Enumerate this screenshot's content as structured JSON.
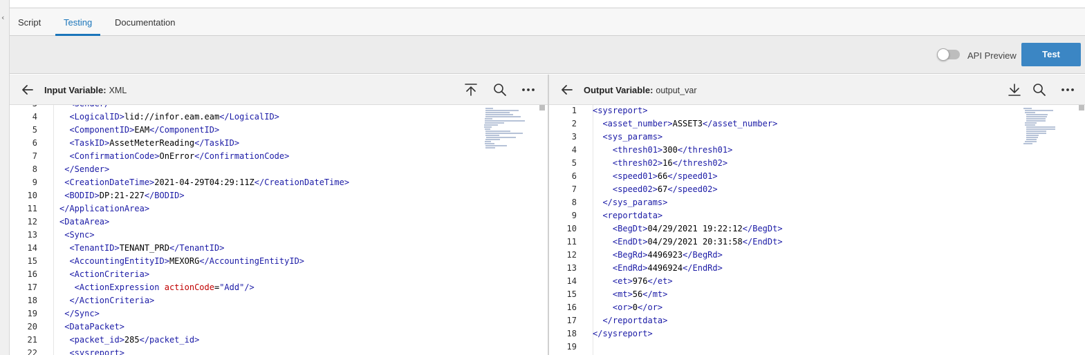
{
  "tabs": [
    {
      "label": "Script",
      "active": false
    },
    {
      "label": "Testing",
      "active": true
    },
    {
      "label": "Documentation",
      "active": false
    }
  ],
  "toolbar": {
    "api_preview_label": "API Preview",
    "api_preview_on": false,
    "test_label": "Test"
  },
  "input_pane": {
    "title_label": "Input Variable:",
    "title_value": "XML",
    "icons": [
      "back-arrow-icon",
      "upload-icon",
      "search-icon",
      "more-icon"
    ],
    "lines": [
      {
        "n": "3",
        "segs": [
          [
            "tag",
            "  <Sender/"
          ]
        ]
      },
      {
        "n": "4",
        "segs": [
          [
            "tag",
            "  <LogicalID>"
          ],
          [
            "txt",
            "lid://infor.eam.eam"
          ],
          [
            "tag",
            "</LogicalID>"
          ]
        ]
      },
      {
        "n": "5",
        "segs": [
          [
            "tag",
            "  <ComponentID>"
          ],
          [
            "txt",
            "EAM"
          ],
          [
            "tag",
            "</ComponentID>"
          ]
        ]
      },
      {
        "n": "6",
        "segs": [
          [
            "tag",
            "  <TaskID>"
          ],
          [
            "txt",
            "AssetMeterReading"
          ],
          [
            "tag",
            "</TaskID>"
          ]
        ]
      },
      {
        "n": "7",
        "segs": [
          [
            "tag",
            "  <ConfirmationCode>"
          ],
          [
            "txt",
            "OnError"
          ],
          [
            "tag",
            "</ConfirmationCode>"
          ]
        ]
      },
      {
        "n": "8",
        "segs": [
          [
            "tag",
            " </Sender>"
          ]
        ]
      },
      {
        "n": "9",
        "segs": [
          [
            "tag",
            " <CreationDateTime>"
          ],
          [
            "txt",
            "2021-04-29T04:29:11Z"
          ],
          [
            "tag",
            "</CreationDateTime>"
          ]
        ]
      },
      {
        "n": "10",
        "segs": [
          [
            "tag",
            " <BODID>"
          ],
          [
            "txt",
            "DP:21-227"
          ],
          [
            "tag",
            "</BODID>"
          ]
        ]
      },
      {
        "n": "11",
        "segs": [
          [
            "tag",
            "</ApplicationArea>"
          ]
        ]
      },
      {
        "n": "12",
        "segs": [
          [
            "tag",
            "<DataArea>"
          ]
        ]
      },
      {
        "n": "13",
        "segs": [
          [
            "tag",
            " <Sync>"
          ]
        ]
      },
      {
        "n": "14",
        "segs": [
          [
            "tag",
            "  <TenantID>"
          ],
          [
            "txt",
            "TENANT_PRD"
          ],
          [
            "tag",
            "</TenantID>"
          ]
        ]
      },
      {
        "n": "15",
        "segs": [
          [
            "tag",
            "  <AccountingEntityID>"
          ],
          [
            "txt",
            "MEXORG"
          ],
          [
            "tag",
            "</AccountingEntityID>"
          ]
        ]
      },
      {
        "n": "16",
        "segs": [
          [
            "tag",
            "  <ActionCriteria>"
          ]
        ]
      },
      {
        "n": "17",
        "segs": [
          [
            "tag",
            "   <ActionExpression "
          ],
          [
            "attr",
            "actionCode"
          ],
          [
            "txt",
            "="
          ],
          [
            "str",
            "\"Add\""
          ],
          [
            "tag",
            "/>"
          ]
        ]
      },
      {
        "n": "18",
        "segs": [
          [
            "tag",
            "  </ActionCriteria>"
          ]
        ]
      },
      {
        "n": "19",
        "segs": [
          [
            "tag",
            " </Sync>"
          ]
        ]
      },
      {
        "n": "20",
        "segs": [
          [
            "tag",
            " <DataPacket>"
          ]
        ]
      },
      {
        "n": "21",
        "segs": [
          [
            "tag",
            "  <packet_id>"
          ],
          [
            "txt",
            "285"
          ],
          [
            "tag",
            "</packet_id>"
          ]
        ]
      },
      {
        "n": "22",
        "segs": [
          [
            "tag",
            "  <sysreport>"
          ]
        ]
      }
    ]
  },
  "output_pane": {
    "title_label": "Output Variable:",
    "title_value": "output_var",
    "icons": [
      "back-arrow-icon",
      "download-icon",
      "search-icon",
      "more-icon"
    ],
    "lines": [
      {
        "n": "1",
        "segs": [
          [
            "tag",
            "<sysreport>"
          ]
        ]
      },
      {
        "n": "2",
        "segs": [
          [
            "tag",
            "  <asset_number>"
          ],
          [
            "txt",
            "ASSET3"
          ],
          [
            "tag",
            "</asset_number>"
          ]
        ]
      },
      {
        "n": "3",
        "segs": [
          [
            "tag",
            "  <sys_params>"
          ]
        ]
      },
      {
        "n": "4",
        "segs": [
          [
            "tag",
            "    <thresh01>"
          ],
          [
            "txt",
            "300"
          ],
          [
            "tag",
            "</thresh01>"
          ]
        ]
      },
      {
        "n": "5",
        "segs": [
          [
            "tag",
            "    <thresh02>"
          ],
          [
            "txt",
            "16"
          ],
          [
            "tag",
            "</thresh02>"
          ]
        ]
      },
      {
        "n": "6",
        "segs": [
          [
            "tag",
            "    <speed01>"
          ],
          [
            "txt",
            "66"
          ],
          [
            "tag",
            "</speed01>"
          ]
        ]
      },
      {
        "n": "7",
        "segs": [
          [
            "tag",
            "    <speed02>"
          ],
          [
            "txt",
            "67"
          ],
          [
            "tag",
            "</speed02>"
          ]
        ]
      },
      {
        "n": "8",
        "segs": [
          [
            "tag",
            "  </sys_params>"
          ]
        ]
      },
      {
        "n": "9",
        "segs": [
          [
            "tag",
            "  <reportdata>"
          ]
        ]
      },
      {
        "n": "10",
        "segs": [
          [
            "tag",
            "    <BegDt>"
          ],
          [
            "txt",
            "04/29/2021 19:22:12"
          ],
          [
            "tag",
            "</BegDt>"
          ]
        ]
      },
      {
        "n": "11",
        "segs": [
          [
            "tag",
            "    <EndDt>"
          ],
          [
            "txt",
            "04/29/2021 20:31:58"
          ],
          [
            "tag",
            "</EndDt>"
          ]
        ]
      },
      {
        "n": "12",
        "segs": [
          [
            "tag",
            "    <BegRd>"
          ],
          [
            "txt",
            "4496923"
          ],
          [
            "tag",
            "</BegRd>"
          ]
        ]
      },
      {
        "n": "13",
        "segs": [
          [
            "tag",
            "    <EndRd>"
          ],
          [
            "txt",
            "4496924"
          ],
          [
            "tag",
            "</EndRd>"
          ]
        ]
      },
      {
        "n": "14",
        "segs": [
          [
            "tag",
            "    <et>"
          ],
          [
            "txt",
            "976"
          ],
          [
            "tag",
            "</et>"
          ]
        ]
      },
      {
        "n": "15",
        "segs": [
          [
            "tag",
            "    <mt>"
          ],
          [
            "txt",
            "56"
          ],
          [
            "tag",
            "</mt>"
          ]
        ]
      },
      {
        "n": "16",
        "segs": [
          [
            "tag",
            "    <or>"
          ],
          [
            "txt",
            "0"
          ],
          [
            "tag",
            "</or>"
          ]
        ]
      },
      {
        "n": "17",
        "segs": [
          [
            "tag",
            "  </reportdata>"
          ]
        ]
      },
      {
        "n": "18",
        "segs": [
          [
            "tag",
            "</sysreport>"
          ]
        ]
      },
      {
        "n": "19",
        "segs": []
      }
    ]
  },
  "colors": {
    "accent": "#1a75ba",
    "test_button": "#3b86c4",
    "xml_tag": "#1a1aa6",
    "xml_attr": "#c00000"
  }
}
